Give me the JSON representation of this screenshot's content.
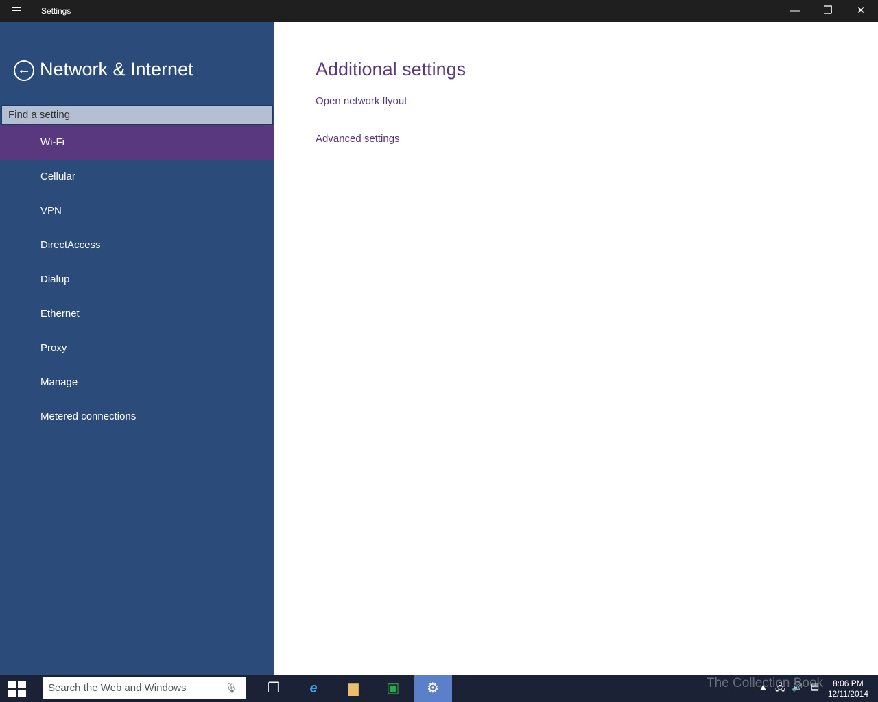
{
  "window": {
    "title": "Settings",
    "minimize": "—",
    "restore": "❐",
    "close": "✕"
  },
  "sidebar": {
    "section_title": "Network & Internet",
    "search_placeholder": "Find a setting",
    "items": [
      {
        "label": "Wi-Fi",
        "selected": true
      },
      {
        "label": "Cellular"
      },
      {
        "label": "VPN"
      },
      {
        "label": "DirectAccess"
      },
      {
        "label": "Dialup"
      },
      {
        "label": "Ethernet"
      },
      {
        "label": "Proxy"
      },
      {
        "label": "Manage"
      },
      {
        "label": "Metered connections"
      }
    ]
  },
  "main": {
    "title": "Additional settings",
    "links": [
      "Open network flyout",
      "Advanced settings"
    ]
  },
  "colors": {
    "sidebar": "#2b4c7a",
    "accent": "#5a3880",
    "titlebar": "#1f1f1f",
    "taskbar": "#1b2236"
  },
  "taskbar": {
    "search_placeholder": "Search the Web and Windows",
    "time": "8:06 PM",
    "date": "12/11/2014",
    "icons": [
      "task-view-icon",
      "internet-explorer-icon",
      "file-explorer-icon",
      "store-icon",
      "settings-icon"
    ]
  },
  "watermark": "The Collection Book"
}
